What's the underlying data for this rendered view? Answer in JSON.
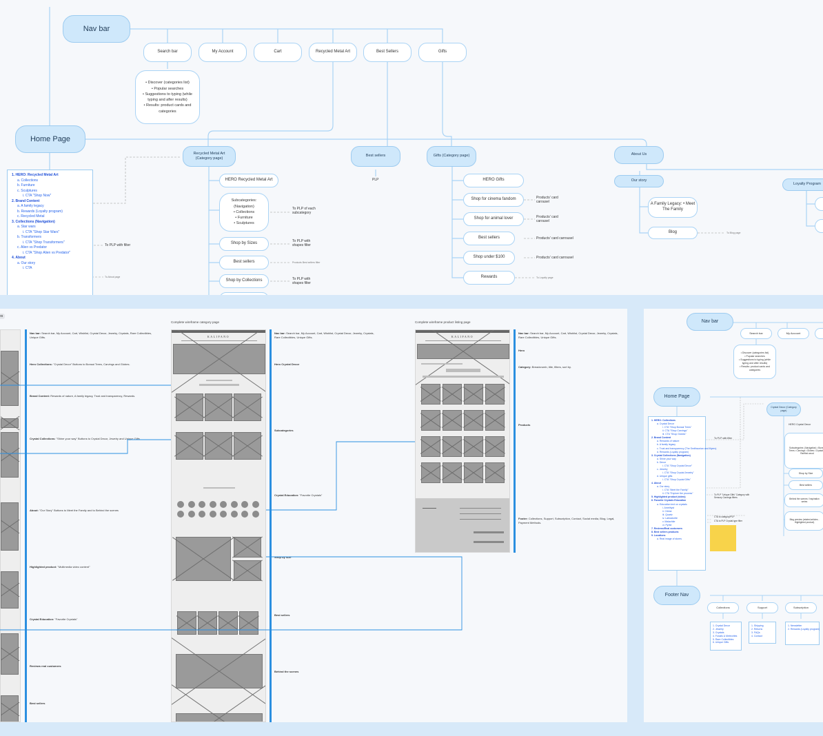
{
  "top": {
    "nav_bar": "Nav bar",
    "nav_items": [
      "Search bar",
      "My Account",
      "Cart",
      "Recycled Metal Art",
      "Best Sellers",
      "Gifts"
    ],
    "search_detail": [
      "• Discover (categories list)",
      "• Popular searches",
      "• Suggestions to typing (while typing and after results)",
      "• Results: product cards and categories"
    ],
    "home_page": "Home Page",
    "home_outline": [
      {
        "t": "1. HERO: Recycled Metal Art",
        "l": 0
      },
      {
        "t": "a. Collections",
        "l": 1
      },
      {
        "t": "b. Furniture",
        "l": 1
      },
      {
        "t": "c. Sculptures",
        "l": 1
      },
      {
        "t": "i. CTA \"Shop Now\"",
        "l": 2
      },
      {
        "t": "2. Brand Content",
        "l": 0
      },
      {
        "t": "a. A family legacy",
        "l": 1
      },
      {
        "t": "b. Rewards (Loyalty program)",
        "l": 1
      },
      {
        "t": "c. Recycled Metal",
        "l": 1
      },
      {
        "t": "3. Collections (Navigation)",
        "l": 0
      },
      {
        "t": "a. Star wars",
        "l": 1
      },
      {
        "t": "i. CTA \"Shop Star Wars\"",
        "l": 2
      },
      {
        "t": "b. Transformers",
        "l": 1
      },
      {
        "t": "i. CTA \"Shop Transformers\"",
        "l": 2
      },
      {
        "t": "c. Alien vs Predator",
        "l": 1
      },
      {
        "t": "i. CTA \"Shop Alien vs Predator\"",
        "l": 2
      },
      {
        "t": "4. About",
        "l": 0
      },
      {
        "t": "a. Our story",
        "l": 1
      },
      {
        "t": "i. CTA",
        "l": 2
      }
    ],
    "to_plp_filter": "To PLP with filter",
    "to_about": "To About page",
    "rma_category": "Recycled Metal Art (Category page)",
    "rma_children": [
      "HERO Recycled Metal Art",
      "Shop by Sizes",
      "Best sellers",
      "Shop by Collections"
    ],
    "subcat_title": "Subcategories: (Navigation)",
    "subcat_items": [
      "• Collections",
      "• Furniture",
      "• Sculptures"
    ],
    "to_plp_each": "To PLP of each subcategory",
    "to_plp_shapes": "To PLP with shapes filter",
    "products_best": "Products Best sellers filter",
    "to_plp_shapes2": "To PLP with shapes filter",
    "best_sellers": "Best sellers",
    "plp": "PLP",
    "gifts_category": "Gifts (Category page)",
    "gifts_children": [
      "HERO Gifts",
      "Shop for cinema fandom",
      "Shop for animal lover",
      "Best sellers",
      "Shop under $100",
      "Rewards"
    ],
    "carousel": "Products' card carousel",
    "carousel2": "Products' card carousel",
    "carousel3": "Products' card carrousel",
    "carousel4": "Products' card carrousel",
    "to_loyalty": "To Loyalty page",
    "about_us": "About Us",
    "our_story": "Our story",
    "family_legacy": "A Family Legacy: • Meet The Family",
    "blog": "Blog",
    "to_blog": "To Blog page",
    "loyalty": "Loyalty Program"
  },
  "mid": {
    "tag": "es",
    "cap_category": "Complete wireframe category page",
    "cap_plp": "Complete wireframe product listing page",
    "brand": "KALIFANO",
    "left_annotations": [
      {
        "title": "Nav bar:",
        "text": "Search bar, My Account, Cart, Wishlist, Crystal Decor, Jewelry, Crystals, Rare Collectibles, Unique Gifts."
      },
      {
        "title": "Hero Collections:",
        "text": "\"Crystal Decor\" Buttons to Bonsai Trees, Carvings and Globes."
      },
      {
        "title": "Brand Content:",
        "text": "Rewards of nature, A family legacy, Trust and transparency, Rewards."
      },
      {
        "title": "Crystal Collections:",
        "text": "\"Shine your way\" Buttons to Crystal Decor, Jewelry and Unique Gifts"
      },
      {
        "title": "About:",
        "text": "\"Our Story\" Buttons to Meet the Family and to Behind the scenes"
      },
      {
        "title": "Highlighted product:",
        "text": "\"Multimedia video content\""
      },
      {
        "title": "Crystal Education:",
        "text": "\"Favorite Crystals\""
      },
      {
        "title": "Reviews real customers",
        "text": ""
      },
      {
        "title": "Best sellers",
        "text": ""
      }
    ],
    "cat_annotations": [
      {
        "title": "Nav bar:",
        "text": "Search bar, My Account, Cart, Wishlist, Crystal Decor, Jewelry, Crystals, Rare Collectibles, Unique Gifts."
      },
      {
        "title": "Hero Crystal Decor",
        "text": ""
      },
      {
        "title": "Subcategories",
        "text": ""
      },
      {
        "title": "Crystal Education:",
        "text": "\"Favorite Crystals\""
      },
      {
        "title": "Shop by size",
        "text": ""
      },
      {
        "title": "Best sellers",
        "text": ""
      },
      {
        "title": "Behind the scenes",
        "text": ""
      }
    ],
    "plp_annotations": [
      {
        "title": "Nav bar:",
        "text": "Search bar, My Account, Cart, Wishlist, Crystal Decor, Jewelry, Crystals, Rare Collectibles, Unique Gifts."
      },
      {
        "title": "Hero",
        "text": ""
      },
      {
        "title": "Category:",
        "text": "Breadcrumb, title, filters, sort by."
      },
      {
        "title": "Products",
        "text": ""
      },
      {
        "title": "Footer:",
        "text": "Collections, Support, Subscription, Contact, Social media, Blog, Legal, Payment Methods."
      }
    ]
  },
  "right": {
    "nav_bar": "Nav bar",
    "nav_items": [
      "Search bar",
      "My Account"
    ],
    "search_detail": [
      "• Discover (categories list)",
      "• Popular searches",
      "• Suggestions to typing (while typing and after results)",
      "• Results: product cards and categories"
    ],
    "home_page": "Home Page",
    "outline": [
      {
        "t": "1. HERO: Collections",
        "l": 0
      },
      {
        "t": "a. Crystal Decor",
        "l": 1
      },
      {
        "t": "i. CTA \"Shop Bonsai Trees\"",
        "l": 2
      },
      {
        "t": "ii. CTA \"Shop Carvings\"",
        "l": 2
      },
      {
        "t": "iii. CTA \"Shop Globes\"",
        "l": 2
      },
      {
        "t": "2. Brand Content",
        "l": 0
      },
      {
        "t": "a. Rewards of nature",
        "l": 1
      },
      {
        "t": "b. A family legacy",
        "l": 1
      },
      {
        "t": "c. Trust and transparency (The Smithsonian and Myers)",
        "l": 1
      },
      {
        "t": "d. Rewards (Loyalty program)",
        "l": 1
      },
      {
        "t": "3. Crystal Collections (Navigation)",
        "l": 0
      },
      {
        "t": "a. Shine your way",
        "l": 1
      },
      {
        "t": "b. Decor",
        "l": 1
      },
      {
        "t": "i. CTA \"Shop Crystal Decor\"",
        "l": 2
      },
      {
        "t": "c. Jewelry",
        "l": 1
      },
      {
        "t": "i. CTA \"Shop Crystal Jewelry\"",
        "l": 2
      },
      {
        "t": "d. Unique gifts",
        "l": 1
      },
      {
        "t": "i. CTA \"Shop Crystal Gifts\"",
        "l": 2
      },
      {
        "t": "4. About",
        "l": 0
      },
      {
        "t": "a. Our story",
        "l": 1
      },
      {
        "t": "i. CTA \"Meet the Family\"",
        "l": 2
      },
      {
        "t": "ii. CTA \"Explore the process\"",
        "l": 2
      },
      {
        "t": "5. Highlighted product (video)",
        "l": 0
      },
      {
        "t": "6. Favorite Crystals Education",
        "l": 0
      },
      {
        "t": "a. Education text on crystals",
        "l": 1
      },
      {
        "t": "i. Amethyst",
        "l": 2
      },
      {
        "t": "ii. Citrine",
        "l": 2
      },
      {
        "t": "iii. Quartz",
        "l": 2
      },
      {
        "t": "iv. Labradorite",
        "l": 2
      },
      {
        "t": "v. Malachite",
        "l": 2
      },
      {
        "t": "vi. Pyrite",
        "l": 2
      },
      {
        "t": "7. Reviews/Real customers",
        "l": 0
      },
      {
        "t": "8. Best sellers products",
        "l": 0
      },
      {
        "t": "9. Locations",
        "l": 0
      },
      {
        "t": "a. Real image of stores",
        "l": 1
      }
    ],
    "to_plp_filter": "To PLP with filter",
    "to_plp_unique": "To PLP \"Unique Gifts\" Category with Sensory Carvings filters",
    "cta_category": "CTA to category/PLP",
    "cta_crystal": "CTA to PLP Crystal type filter",
    "crystal_decor": "Crystal Decor (Category page)",
    "hero_crystal": "HERO Crystal Decor",
    "subcat": "Subcategories: (Navigation) • Bonsai Trees • Carvings • Globes • Crystals • Rarified wood",
    "shop_by_size": "Shop by Size",
    "best_sellers": "Best sellers",
    "behind": "Behind the scenes / Inspiration series",
    "blog_preview": "Blog preview (related articles - Highlighted product)",
    "footer_nav": "Footer Nav",
    "footer_cols": [
      "Collections",
      "Support",
      "Subscription"
    ],
    "col1": [
      "1. Crystal Decor",
      "2. Jewelry",
      "3. Crystals",
      "4. Fossils & Meteorites",
      "5. Rare Collectibles",
      "6. Unique Gifts"
    ],
    "col2": [
      "1. Shipping",
      "2. Returns",
      "3. FAQs",
      "4. Contact"
    ],
    "col3": [
      "1. Newsletter",
      "2. Rewards (Loyalty program)"
    ]
  }
}
